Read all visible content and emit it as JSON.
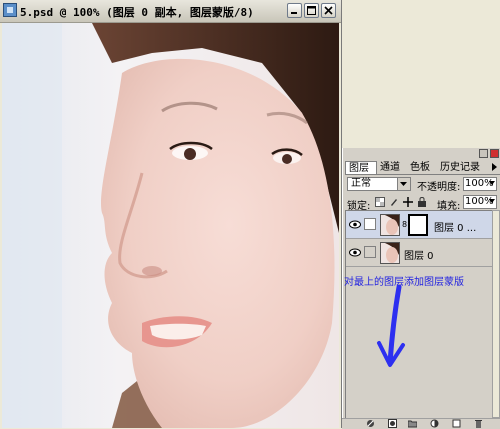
{
  "document": {
    "title": "5.psd @ 100% (图层 0 副本, 图层蒙版/8)"
  },
  "layers_panel": {
    "tabs": [
      "图层",
      "通道",
      "色板",
      "历史记录"
    ],
    "blend_mode": "正常",
    "opacity_label": "不透明度:",
    "opacity_value": "100%",
    "lock_label": "锁定:",
    "fill_label": "填充:",
    "fill_value": "100%",
    "layers": [
      {
        "name": "图层 0 ...",
        "has_mask": true,
        "selected": true,
        "visible": true
      },
      {
        "name": "图层 0",
        "has_mask": false,
        "selected": false,
        "visible": true
      }
    ]
  },
  "annotation": {
    "text": "对最上的图层添加图层蒙版",
    "color": "#2323e0"
  },
  "icons": {
    "titlebar": [
      "photoshop-doc-icon",
      "minimize-icon",
      "maximize-icon",
      "close-icon"
    ],
    "bottom_bar": [
      "link-layers-icon",
      "add-layer-style-icon",
      "add-layer-mask-icon",
      "new-set-icon",
      "new-adjustment-layer-icon",
      "new-layer-icon",
      "trash-icon"
    ]
  }
}
